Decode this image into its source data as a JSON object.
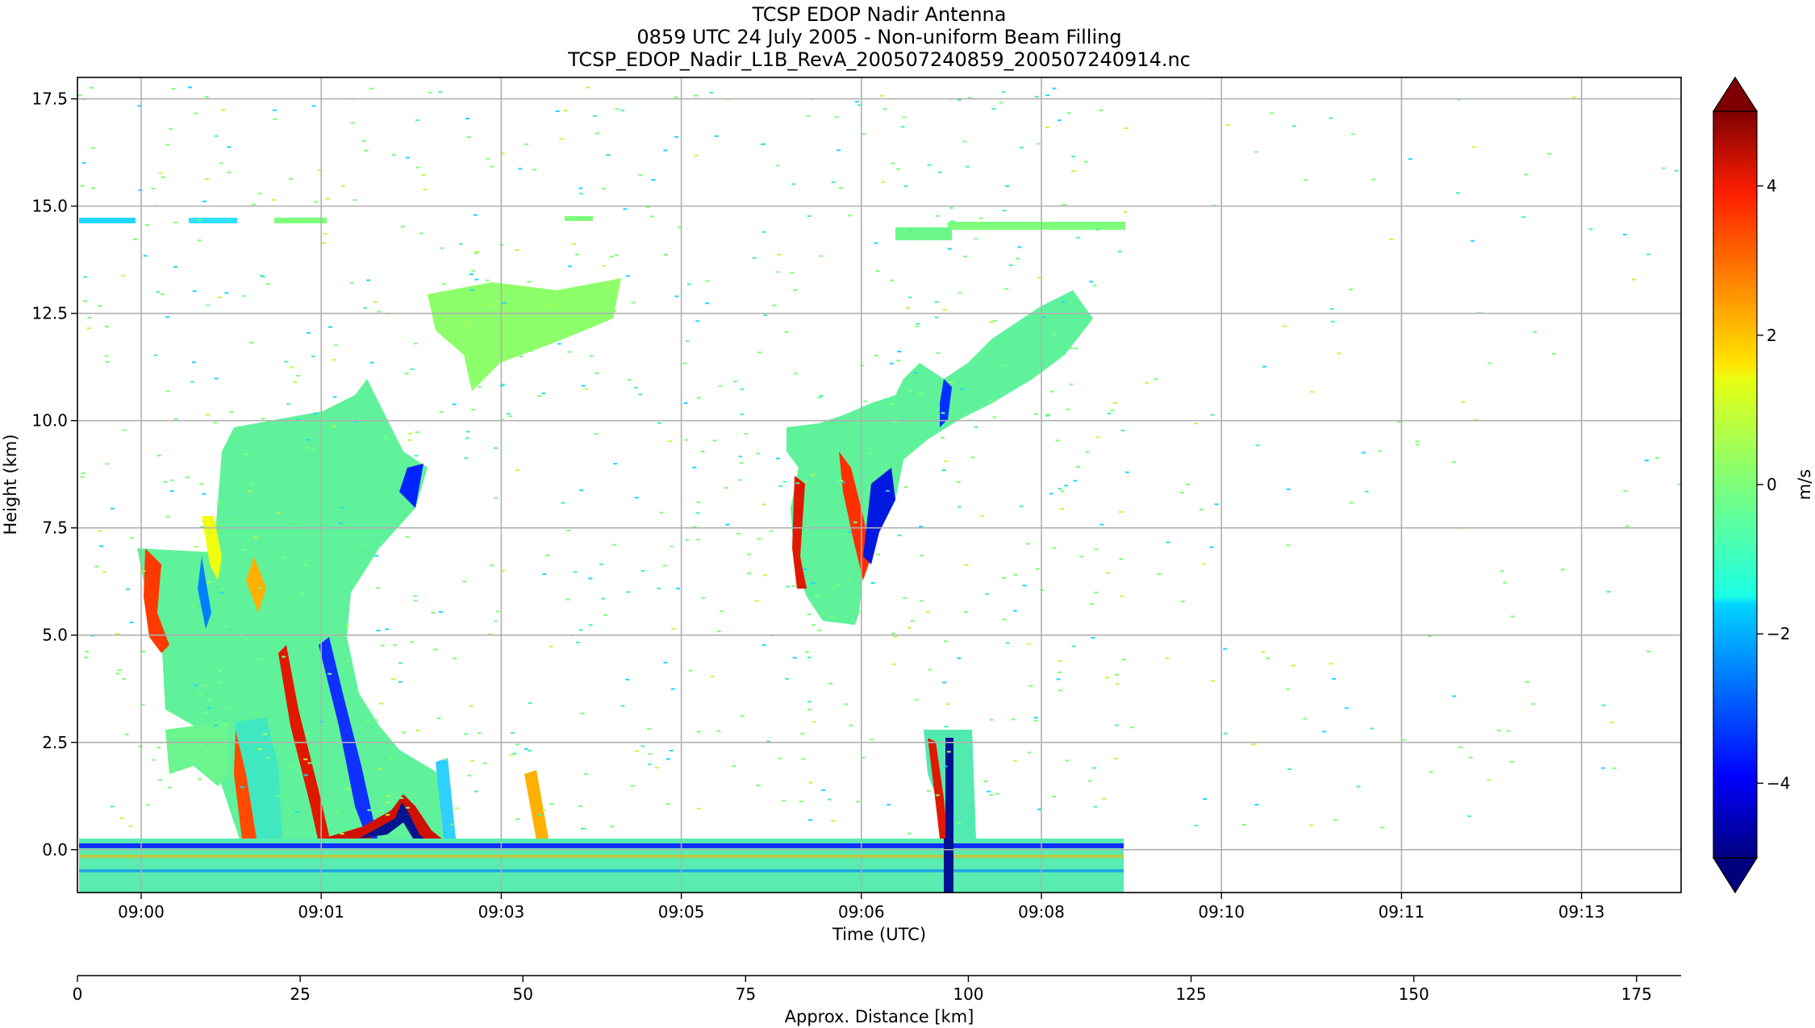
{
  "chart_data": {
    "type": "heatmap",
    "title_lines": [
      "TCSP EDOP Nadir Antenna",
      "0859 UTC 24 July 2005 - Non-uniform Beam Filling",
      "TCSP_EDOP_Nadir_L1B_RevA_200507240859_200507240914.nc"
    ],
    "xlabel": "Time (UTC)",
    "ylabel": "Height (km)",
    "x2label": "Approx. Distance [km]",
    "colorbar_label": "m/s",
    "colormap": "jet",
    "color_range": [
      -5,
      5
    ],
    "colorbar_extend": "both",
    "grid": true,
    "x_time_ticks": [
      "09:00",
      "09:01",
      "09:03",
      "09:05",
      "09:06",
      "09:08",
      "09:10",
      "09:11",
      "09:13"
    ],
    "y_range_km": [
      -1.0,
      18.0
    ],
    "y_ticks": [
      0.0,
      2.5,
      5.0,
      7.5,
      10.0,
      12.5,
      15.0,
      17.5
    ],
    "y_tick_labels": [
      "0.0",
      "2.5",
      "5.0",
      "7.5",
      "10.0",
      "12.5",
      "15.0",
      "17.5"
    ],
    "x2_range_km": [
      0,
      180
    ],
    "x2_ticks": [
      0,
      25,
      50,
      75,
      100,
      125,
      150,
      175
    ],
    "x2_tick_labels": [
      "0",
      "25",
      "50",
      "75",
      "100",
      "125",
      "150",
      "175"
    ],
    "colorbar_ticks": [
      4,
      2,
      0,
      -2,
      -4
    ],
    "colorbar_tick_labels": [
      "4",
      "2",
      "0",
      "−2",
      "−4"
    ],
    "data_extent_distance_km": [
      0,
      117.5
    ]
  }
}
